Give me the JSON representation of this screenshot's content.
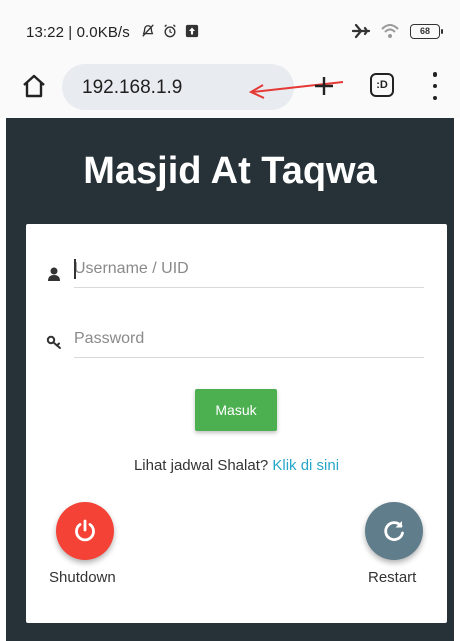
{
  "status_bar": {
    "time_speed": "13:22 | 0.0KB/s",
    "battery": "68",
    "icons_left": [
      "mute-icon",
      "alarm-icon",
      "upload-notification-icon"
    ],
    "icons_right": [
      "airplane-icon",
      "wifi-icon",
      "battery-icon"
    ]
  },
  "browser": {
    "url": "192.168.1.9",
    "tab_count_label": ":D",
    "icons": [
      "home-icon",
      "plus-icon",
      "tabs-icon",
      "menu-icon"
    ],
    "annotation_color": "#e53935"
  },
  "page": {
    "title": "Masjid At Taqwa",
    "background": "#263238",
    "login": {
      "username_placeholder": "Username / UID",
      "password_placeholder": "Password",
      "submit_label": "Masuk",
      "submit_color": "#4caf50"
    },
    "schedule": {
      "prompt": "Lihat jadwal Shalat?",
      "link_text": "Klik di sini",
      "link_color": "#26a6c9"
    },
    "actions": {
      "shutdown_label": "Shutdown",
      "shutdown_color": "#f44336",
      "restart_label": "Restart",
      "restart_color": "#607d8b"
    }
  }
}
